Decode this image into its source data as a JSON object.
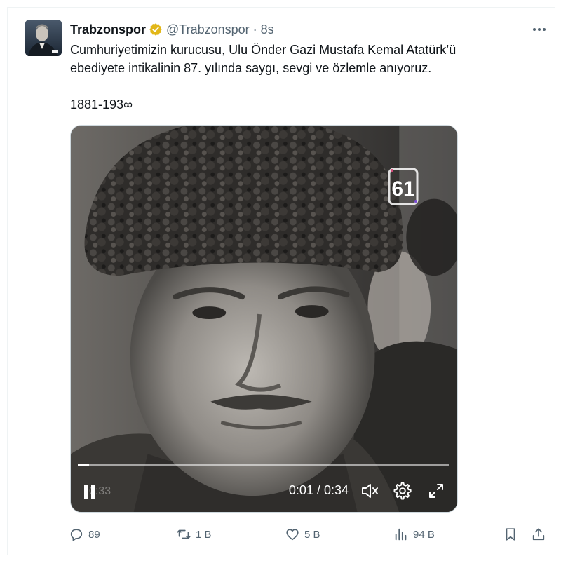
{
  "tweet": {
    "author": {
      "display_name": "Trabzonspor",
      "handle": "@Trabzonspor",
      "verified_badge_color": "#e2b719",
      "avatar_icon": "profile-photo"
    },
    "separator": "·",
    "time_ago": "8s",
    "text_line_1": "Cumhuriyetimizin kurucusu, Ulu Önder Gazi Mustafa Kemal Atatürk’ü",
    "text_line_2": "ebediyete intikalinin 87. yılında saygı, sevgi ve özlemle anıyoruz.",
    "years": "1881-193∞",
    "more_icon": "ellipsis-icon"
  },
  "video": {
    "current_time": "0:01",
    "time_separator": "/",
    "duration": "0:34",
    "ghost_time": "0:33",
    "progress_fraction": 0.03,
    "state": "playing",
    "muted": true,
    "icons": {
      "pause": "pause-icon",
      "mute": "volume-muted-icon",
      "settings": "gear-icon",
      "fullscreen": "fullscreen-icon"
    }
  },
  "actions": {
    "replies": "89",
    "retweets": "1 B",
    "likes": "5 B",
    "views": "94 B",
    "icons": {
      "reply": "reply-icon",
      "retweet": "retweet-icon",
      "like": "heart-icon",
      "views": "views-chart-icon",
      "bookmark": "bookmark-icon",
      "share": "share-icon"
    }
  },
  "colors": {
    "text_primary": "#0f1419",
    "text_secondary": "#536471",
    "border": "#eff3f4"
  }
}
